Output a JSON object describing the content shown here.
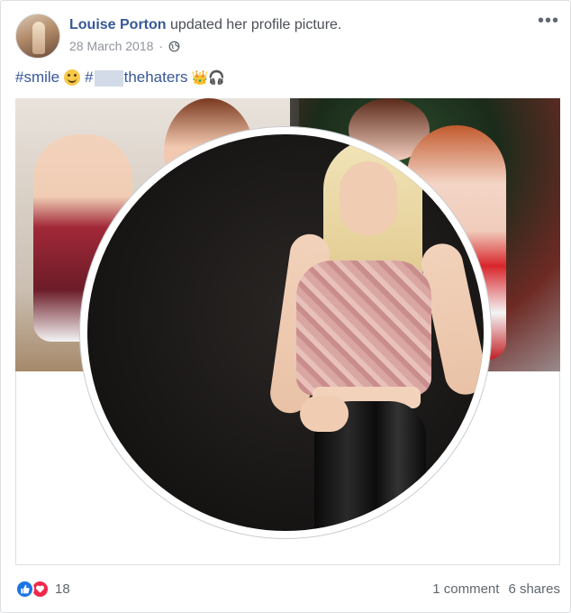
{
  "post": {
    "author": "Louise Porton",
    "action": "updated her profile picture.",
    "date": "28 March 2018",
    "separator": "·",
    "caption": {
      "tag1": "#smile",
      "tag2_prefix": "#",
      "tag2_suffix": "thehaters",
      "emojis_after": "👑🎧"
    },
    "more_label": "•••"
  },
  "stats": {
    "reaction_count": "18",
    "comments": "1 comment",
    "shares": "6 shares"
  },
  "colors": {
    "author_link": "#385898",
    "like_blue": "#1b74e4",
    "love_red": "#f0284a",
    "meta_grey": "#90949c"
  },
  "icons": [
    "globe-icon",
    "more-options-icon",
    "like-icon",
    "love-icon",
    "smile-emoji-icon"
  ]
}
